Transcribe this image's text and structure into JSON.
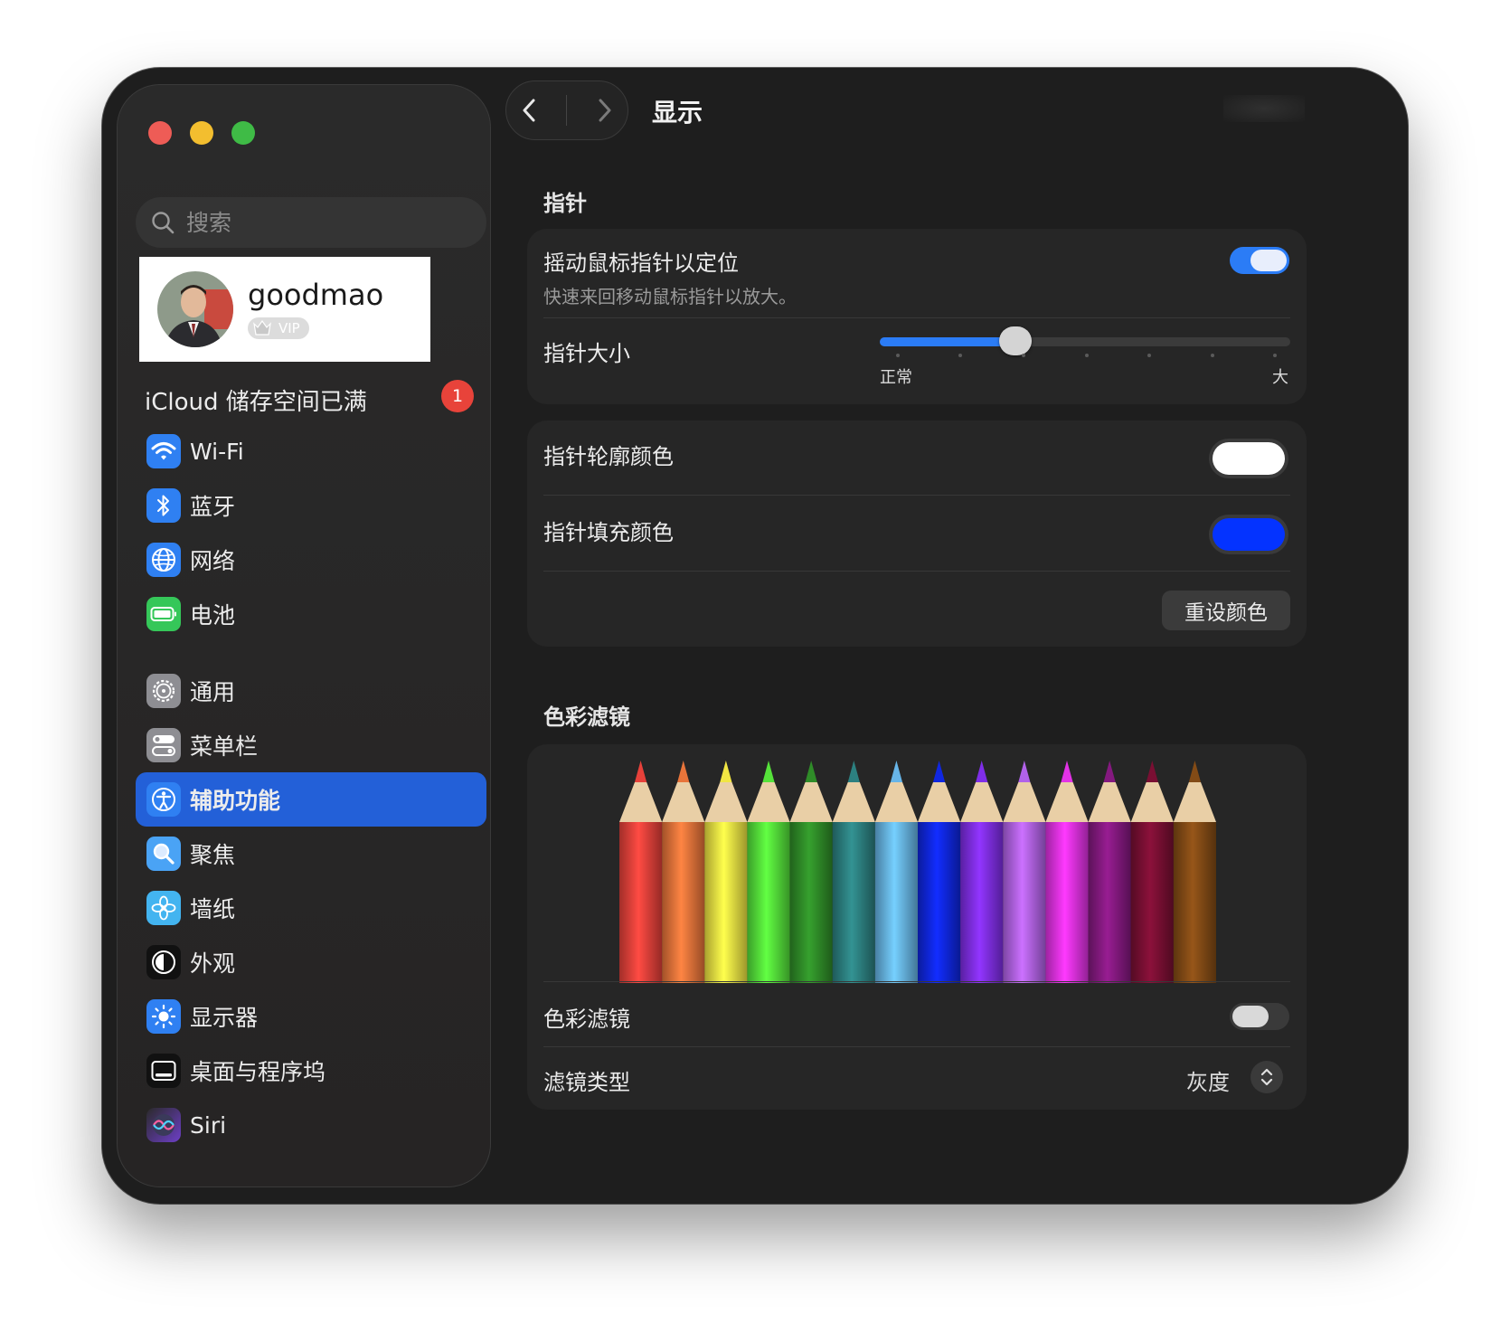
{
  "sidebar": {
    "search_placeholder": "搜索",
    "profile": {
      "name": "goodmao",
      "badge": "VIP"
    },
    "icloud": {
      "label": "iCloud 储存空间已满",
      "count": "1"
    },
    "group1": [
      {
        "id": "wifi",
        "label": "Wi-Fi",
        "icon": "wifi-icon",
        "color": "#2f80f2"
      },
      {
        "id": "bluetooth",
        "label": "蓝牙",
        "icon": "bluetooth-icon",
        "color": "#2f80f2"
      },
      {
        "id": "network",
        "label": "网络",
        "icon": "globe-icon",
        "color": "#2f80f2"
      },
      {
        "id": "battery",
        "label": "电池",
        "icon": "battery-icon",
        "color": "#35c759"
      }
    ],
    "group2": [
      {
        "id": "general",
        "label": "通用",
        "icon": "gear-icon",
        "color": "#8e8e93"
      },
      {
        "id": "menubar",
        "label": "菜单栏",
        "icon": "menubar-icon",
        "color": "#8e8e93"
      },
      {
        "id": "accessibility",
        "label": "辅助功能",
        "icon": "accessibility-icon",
        "color": "#2f80f2",
        "active": true
      },
      {
        "id": "spotlight",
        "label": "聚焦",
        "icon": "magnifier-icon",
        "color": "#4aa3f5"
      },
      {
        "id": "wallpaper",
        "label": "墙纸",
        "icon": "flower-icon",
        "color": "#43b4f0"
      },
      {
        "id": "appearance",
        "label": "外观",
        "icon": "appearance-icon",
        "color": "#111111"
      },
      {
        "id": "displays",
        "label": "显示器",
        "icon": "sun-icon",
        "color": "#2f80f2"
      },
      {
        "id": "desktop",
        "label": "桌面与程序坞",
        "icon": "dock-icon",
        "color": "#111111"
      },
      {
        "id": "siri",
        "label": "Siri",
        "icon": "siri-icon",
        "color": "#7a4ccf"
      }
    ]
  },
  "main": {
    "title": "显示",
    "pointer_section": "指针",
    "shake": {
      "title": "摇动鼠标指针以定位",
      "subtitle": "快速来回移动鼠标指针以放大。",
      "on": true
    },
    "size": {
      "title": "指针大小",
      "min_label": "正常",
      "max_label": "大",
      "value": 0.33
    },
    "outline": {
      "title": "指针轮廓颜色",
      "color": "#ffffff"
    },
    "fill": {
      "title": "指针填充颜色",
      "color": "#0433ff"
    },
    "reset_label": "重设颜色",
    "filter_section": "色彩滤镜",
    "pencils": [
      "#e7413a",
      "#e8743a",
      "#f1e643",
      "#55e23a",
      "#2f8c28",
      "#2c8080",
      "#67b5e8",
      "#1027e0",
      "#7f2ee8",
      "#b162e9",
      "#e232e6",
      "#84197f",
      "#7a0f33",
      "#834b16"
    ],
    "filter_toggle": {
      "title": "色彩滤镜",
      "on": false
    },
    "filter_type": {
      "title": "滤镜类型",
      "value": "灰度"
    }
  }
}
